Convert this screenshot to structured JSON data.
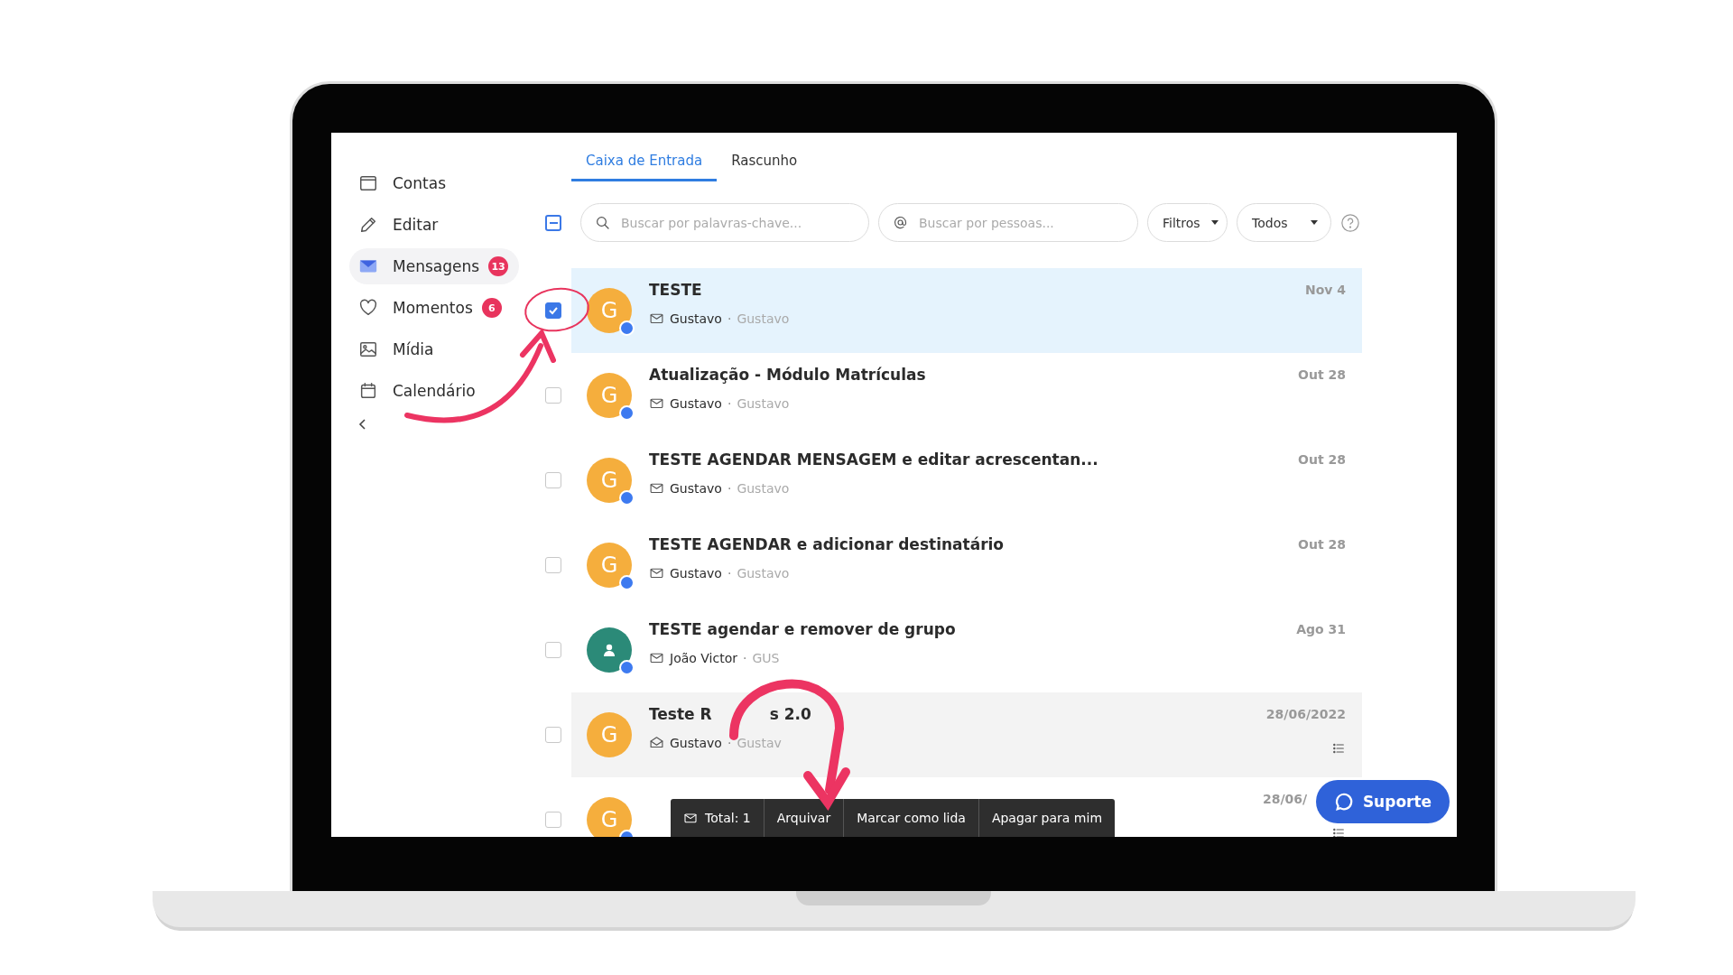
{
  "sidebar": {
    "items": [
      {
        "label": "Contas",
        "selected": false
      },
      {
        "label": "Editar",
        "selected": false
      },
      {
        "label": "Mensagens",
        "selected": true,
        "badge": "13"
      },
      {
        "label": "Momentos",
        "selected": false,
        "badge": "6"
      },
      {
        "label": "Mídia",
        "selected": false
      },
      {
        "label": "Calendário",
        "selected": false
      }
    ]
  },
  "tabs": [
    {
      "label": "Caixa de Entrada",
      "selected": true
    },
    {
      "label": "Rascunho",
      "selected": false
    }
  ],
  "toolbar": {
    "select_all_indeterminate": true,
    "keyword_search": {
      "placeholder": "Buscar por palavras-chave..."
    },
    "people_search": {
      "placeholder": "Buscar por pessoas..."
    },
    "filters": [
      "Filtros",
      "Todos"
    ]
  },
  "messages": [
    {
      "selected": true,
      "checked": true,
      "hovered": false,
      "unread": true,
      "avatar": {
        "kind": "letter",
        "text": "G",
        "color": "#f5ae3d"
      },
      "title_parts": [
        "TESTE"
      ],
      "sender": "Gustavo",
      "separator": "·",
      "recipient": "Gustavo",
      "date": "Nov 4",
      "has_menu": false
    },
    {
      "selected": false,
      "checked": false,
      "hovered": false,
      "unread": true,
      "avatar": {
        "kind": "letter",
        "text": "G",
        "color": "#f5ae3d"
      },
      "title_parts": [
        "Atualização - Módulo Matrículas"
      ],
      "sender": "Gustavo",
      "separator": "·",
      "recipient": "Gustavo",
      "date": "Out 28",
      "has_menu": false
    },
    {
      "selected": false,
      "checked": false,
      "hovered": false,
      "unread": true,
      "avatar": {
        "kind": "letter",
        "text": "G",
        "color": "#f5ae3d"
      },
      "title_parts": [
        "TESTE AGENDAR MENSAGEM e editar acrescentan..."
      ],
      "sender": "Gustavo",
      "separator": "·",
      "recipient": "Gustavo",
      "date": "Out 28",
      "has_menu": false
    },
    {
      "selected": false,
      "checked": false,
      "hovered": false,
      "unread": true,
      "avatar": {
        "kind": "letter",
        "text": "G",
        "color": "#f5ae3d"
      },
      "title_parts": [
        "TESTE AGENDAR e adicionar destinatário"
      ],
      "sender": "Gustavo",
      "separator": "·",
      "recipient": "Gustavo",
      "date": "Out 28",
      "has_menu": false
    },
    {
      "selected": false,
      "checked": false,
      "hovered": false,
      "unread": true,
      "avatar": {
        "kind": "person",
        "color": "#2b8a78"
      },
      "title_parts": [
        "TESTE agendar e remover de grupo"
      ],
      "sender": "João Victor",
      "separator": "·",
      "recipient": "GUS",
      "date": "Ago 31",
      "has_menu": false
    },
    {
      "selected": false,
      "checked": false,
      "hovered": true,
      "unread": false,
      "avatar": {
        "kind": "letter",
        "text": "G",
        "color": "#f5ae3d"
      },
      "title_parts": [
        "Teste R",
        "s 2.0"
      ],
      "sender": "Gustavo",
      "separator": "·",
      "recipient": "Gustav",
      "date": "28/06/2022",
      "has_menu": true
    },
    {
      "selected": false,
      "checked": false,
      "hovered": false,
      "unread": true,
      "avatar": {
        "kind": "letter",
        "text": "G",
        "color": "#f5ae3d"
      },
      "date": "28/06/",
      "has_menu": true
    }
  ],
  "action_bar": {
    "total": "Total: 1",
    "actions": [
      "Arquivar",
      "Marcar como lida",
      "Apagar para mim"
    ]
  },
  "support_button": {
    "label": "Suporte"
  }
}
